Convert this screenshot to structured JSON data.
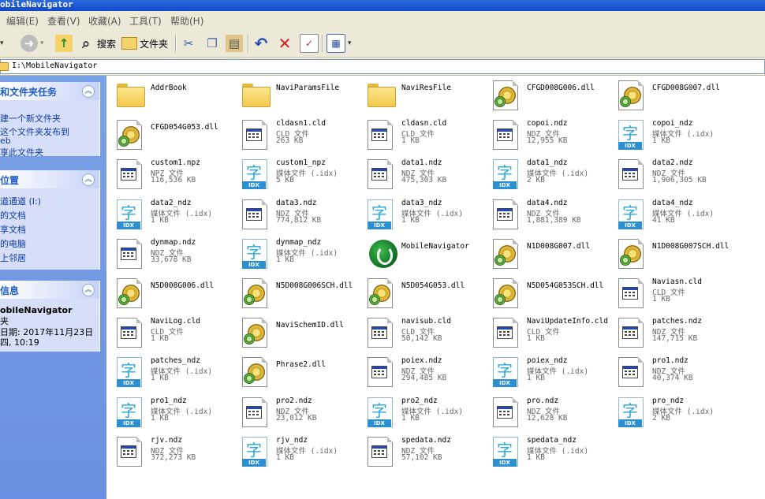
{
  "window": {
    "title": "obileNavigator"
  },
  "menu": [
    "编辑(E)",
    "查看(V)",
    "收藏(A)",
    "工具(T)",
    "帮助(H)"
  ],
  "toolbar": {
    "search": "搜索",
    "folders": "文件夹"
  },
  "address": {
    "path": "I:\\MobileNavigator"
  },
  "tasks_panel": {
    "title": "和文件夹任务",
    "links": [
      "建一个新文件夹",
      "这个文件夹发布到",
      "eb",
      "享此文件夹"
    ]
  },
  "places_panel": {
    "title": "位置",
    "links": [
      "道通道 (I:)",
      "的文档",
      "享文档",
      "的电脑",
      "上邻居"
    ]
  },
  "details_panel": {
    "title": "信息",
    "name": "obileNavigator",
    "type": "夹",
    "modified_line1": "日期: 2017年11月23日",
    "modified_line2": "四, 10:19"
  },
  "files": [
    {
      "name": "AddrBook",
      "kind": "folder"
    },
    {
      "name": "NaviParamsFile",
      "kind": "folder"
    },
    {
      "name": "NaviResFile",
      "kind": "folder"
    },
    {
      "name": "CFGD008G006.dll",
      "kind": "dll"
    },
    {
      "name": "CFGD008G007.dll",
      "kind": "dll"
    },
    {
      "name": "CFGD054G053.dll",
      "kind": "dll"
    },
    {
      "name": "cldasn1.cld",
      "kind": "doc",
      "type": "CLD 文件",
      "size": "263 KB"
    },
    {
      "name": "cldasn.cld",
      "kind": "doc",
      "type": "CLD 文件",
      "size": "1 KB"
    },
    {
      "name": "copoi.ndz",
      "kind": "doc",
      "type": "NDZ 文件",
      "size": "12,955 KB"
    },
    {
      "name": "copoi_ndz",
      "kind": "idx",
      "type": "媒体文件 (.idx)",
      "size": "1 KB"
    },
    {
      "name": "custom1.npz",
      "kind": "doc",
      "type": "NPZ 文件",
      "size": "116,536 KB"
    },
    {
      "name": "custom1_npz",
      "kind": "idx",
      "type": "媒体文件 (.idx)",
      "size": "5 KB"
    },
    {
      "name": "data1.ndz",
      "kind": "doc",
      "type": "NDZ 文件",
      "size": "475,303 KB"
    },
    {
      "name": "data1_ndz",
      "kind": "idx",
      "type": "媒体文件 (.idx)",
      "size": "2 KB"
    },
    {
      "name": "data2.ndz",
      "kind": "doc",
      "type": "NDZ 文件",
      "size": "1,906,305 KB"
    },
    {
      "name": "data2_ndz",
      "kind": "idx",
      "type": "媒体文件 (.idx)",
      "size": "1 KB"
    },
    {
      "name": "data3.ndz",
      "kind": "doc",
      "type": "NDZ 文件",
      "size": "774,812 KB"
    },
    {
      "name": "data3_ndz",
      "kind": "idx",
      "type": "媒体文件 (.idx)",
      "size": "1 KB"
    },
    {
      "name": "data4.ndz",
      "kind": "doc",
      "type": "NDZ 文件",
      "size": "1,881,389 KB"
    },
    {
      "name": "data4_ndz",
      "kind": "idx",
      "type": "媒体文件 (.idx)",
      "size": "41 KB"
    },
    {
      "name": "dynmap.ndz",
      "kind": "doc",
      "type": "NDZ 文件",
      "size": "33,678 KB"
    },
    {
      "name": "dynmap_ndz",
      "kind": "idx",
      "type": "媒体文件 (.idx)",
      "size": "1 KB"
    },
    {
      "name": "MobileNavigator",
      "kind": "app"
    },
    {
      "name": "N1D008G007.dll",
      "kind": "dll"
    },
    {
      "name": "N1D008G007SCH.dll",
      "kind": "dll"
    },
    {
      "name": "N5D008G006.dll",
      "kind": "dll"
    },
    {
      "name": "N5D008G006SCH.dll",
      "kind": "dll"
    },
    {
      "name": "N5D054G053.dll",
      "kind": "dll"
    },
    {
      "name": "N5D054G053SCH.dll",
      "kind": "dll"
    },
    {
      "name": "Naviasn.cld",
      "kind": "doc",
      "type": "CLD 文件",
      "size": "1 KB"
    },
    {
      "name": "NaviLog.cld",
      "kind": "doc",
      "type": "CLD 文件",
      "size": "1 KB"
    },
    {
      "name": "NaviSchemID.dll",
      "kind": "dll"
    },
    {
      "name": "navisub.cld",
      "kind": "doc",
      "type": "CLD 文件",
      "size": "50,142 KB"
    },
    {
      "name": "NaviUpdateInfo.cld",
      "kind": "doc",
      "type": "CLD 文件",
      "size": "1 KB"
    },
    {
      "name": "patches.ndz",
      "kind": "doc",
      "type": "NDZ 文件",
      "size": "147,715 KB"
    },
    {
      "name": "patches_ndz",
      "kind": "idx",
      "type": "媒体文件 (.idx)",
      "size": "1 KB"
    },
    {
      "name": "Phrase2.dll",
      "kind": "dll"
    },
    {
      "name": "poiex.ndz",
      "kind": "doc",
      "type": "NDZ 文件",
      "size": "294,485 KB"
    },
    {
      "name": "poiex_ndz",
      "kind": "idx",
      "type": "媒体文件 (.idx)",
      "size": "1 KB"
    },
    {
      "name": "pro1.ndz",
      "kind": "doc",
      "type": "NDZ 文件",
      "size": "40,374 KB"
    },
    {
      "name": "pro1_ndz",
      "kind": "idx",
      "type": "媒体文件 (.idx)",
      "size": "1 KB"
    },
    {
      "name": "pro2.ndz",
      "kind": "doc",
      "type": "NDZ 文件",
      "size": "23,012 KB"
    },
    {
      "name": "pro2_ndz",
      "kind": "idx",
      "type": "媒体文件 (.idx)",
      "size": "1 KB"
    },
    {
      "name": "pro.ndz",
      "kind": "doc",
      "type": "NDZ 文件",
      "size": "12,628 KB"
    },
    {
      "name": "pro_ndz",
      "kind": "idx",
      "type": "媒体文件 (.idx)",
      "size": "2 KB"
    },
    {
      "name": "rjv.ndz",
      "kind": "doc",
      "type": "NDZ 文件",
      "size": "372,273 KB"
    },
    {
      "name": "rjv_ndz",
      "kind": "idx",
      "type": "媒体文件 (.idx)",
      "size": "1 KB"
    },
    {
      "name": "spedata.ndz",
      "kind": "doc",
      "type": "NDZ 文件",
      "size": "57,102 KB"
    },
    {
      "name": "spedata_ndz",
      "kind": "idx",
      "type": "媒体文件 (.idx)",
      "size": "1 KB"
    }
  ]
}
